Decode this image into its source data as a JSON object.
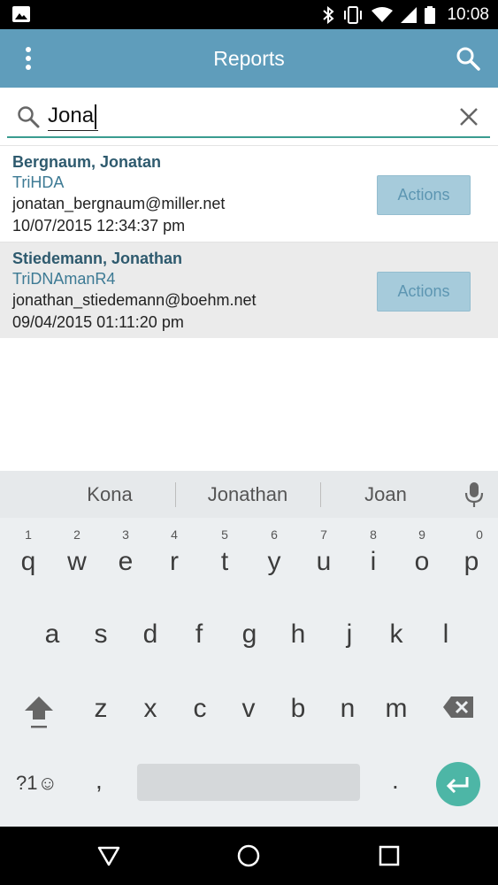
{
  "status_bar": {
    "time": "10:08",
    "icons": [
      "photo-icon",
      "bluetooth-icon",
      "vibrate-icon",
      "wifi-icon",
      "signal-icon",
      "battery-icon"
    ]
  },
  "app_bar": {
    "title": "Reports",
    "icons": [
      "overflow-menu-icon",
      "search-icon"
    ],
    "background_color": "#5f9dbb"
  },
  "search": {
    "query": "Jona",
    "underline_color": "#3a9c90"
  },
  "results": [
    {
      "name": "Bergnaum, Jonatan",
      "org": "TriHDA",
      "email": "jonatan_bergnaum@miller.net",
      "date": "10/07/2015 12:34:37 pm",
      "action_label": "Actions"
    },
    {
      "name": "Stiedemann, Jonathan",
      "org": "TriDNAmanR4",
      "email": "jonathan_stiedemann@boehm.net",
      "date": "09/04/2015 01:11:20 pm",
      "action_label": "Actions"
    }
  ],
  "keyboard": {
    "suggestions": [
      "Kona",
      "Jonathan",
      "Joan"
    ],
    "row1": [
      {
        "key": "q",
        "hint": "1"
      },
      {
        "key": "w",
        "hint": "2"
      },
      {
        "key": "e",
        "hint": "3"
      },
      {
        "key": "r",
        "hint": "4"
      },
      {
        "key": "t",
        "hint": "5"
      },
      {
        "key": "y",
        "hint": "6"
      },
      {
        "key": "u",
        "hint": "7"
      },
      {
        "key": "i",
        "hint": "8"
      },
      {
        "key": "o",
        "hint": "9"
      },
      {
        "key": "p",
        "hint": "0"
      }
    ],
    "row2": [
      "a",
      "s",
      "d",
      "f",
      "g",
      "h",
      "j",
      "k",
      "l"
    ],
    "row3": [
      "z",
      "x",
      "c",
      "v",
      "b",
      "n",
      "m"
    ],
    "symbols_label": "?1☺",
    "comma": ",",
    "period": ".",
    "enter_color": "#4db6a6"
  },
  "nav_bar": {
    "icons": [
      "back-icon",
      "home-icon",
      "recents-icon"
    ]
  }
}
